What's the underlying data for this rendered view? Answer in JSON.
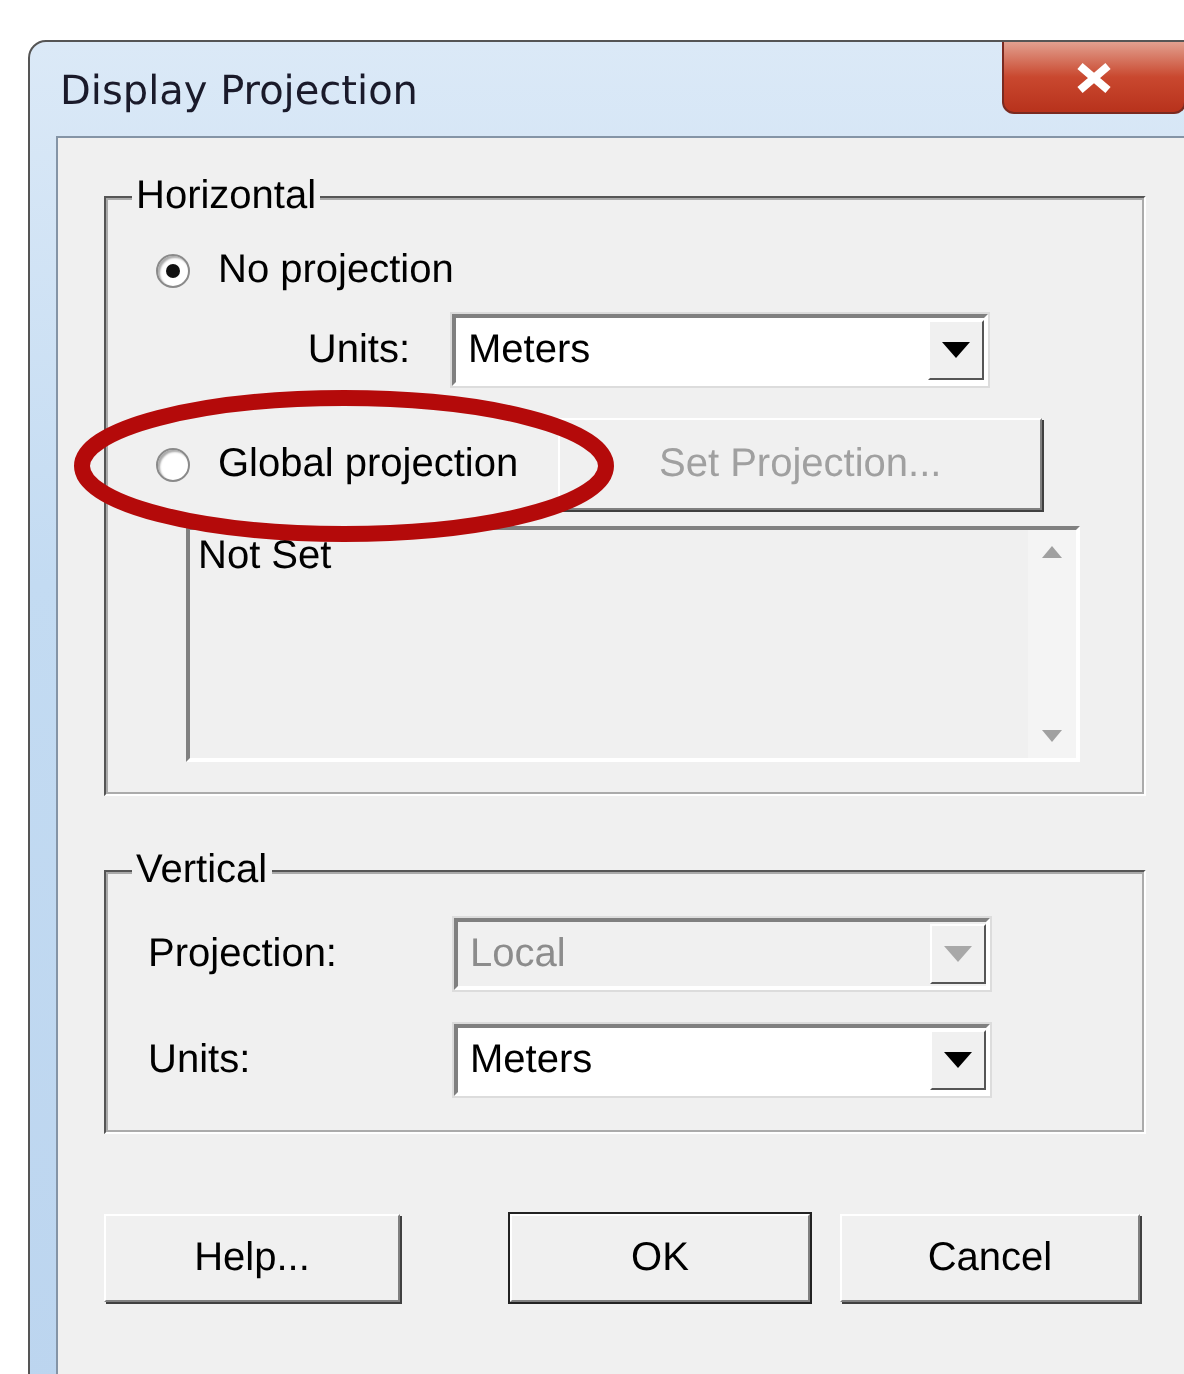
{
  "window": {
    "title": "Display Projection"
  },
  "horizontal": {
    "label": "Horizontal",
    "options": [
      {
        "label": "No projection",
        "selected": true
      },
      {
        "label": "Global projection",
        "selected": false
      }
    ],
    "units_label": "Units:",
    "units_value": "Meters",
    "set_projection": {
      "label": "Set Projection...",
      "disabled": true
    },
    "description": "Not Set"
  },
  "vertical": {
    "label": "Vertical",
    "projection_label": "Projection:",
    "projection_value": "Local",
    "projection_disabled": true,
    "units_label": "Units:",
    "units_value": "Meters"
  },
  "buttons": [
    {
      "label": "Help...",
      "default": false
    },
    {
      "label": "OK",
      "default": true
    },
    {
      "label": "Cancel",
      "default": false
    }
  ],
  "annotation": {
    "kind": "ellipse"
  }
}
